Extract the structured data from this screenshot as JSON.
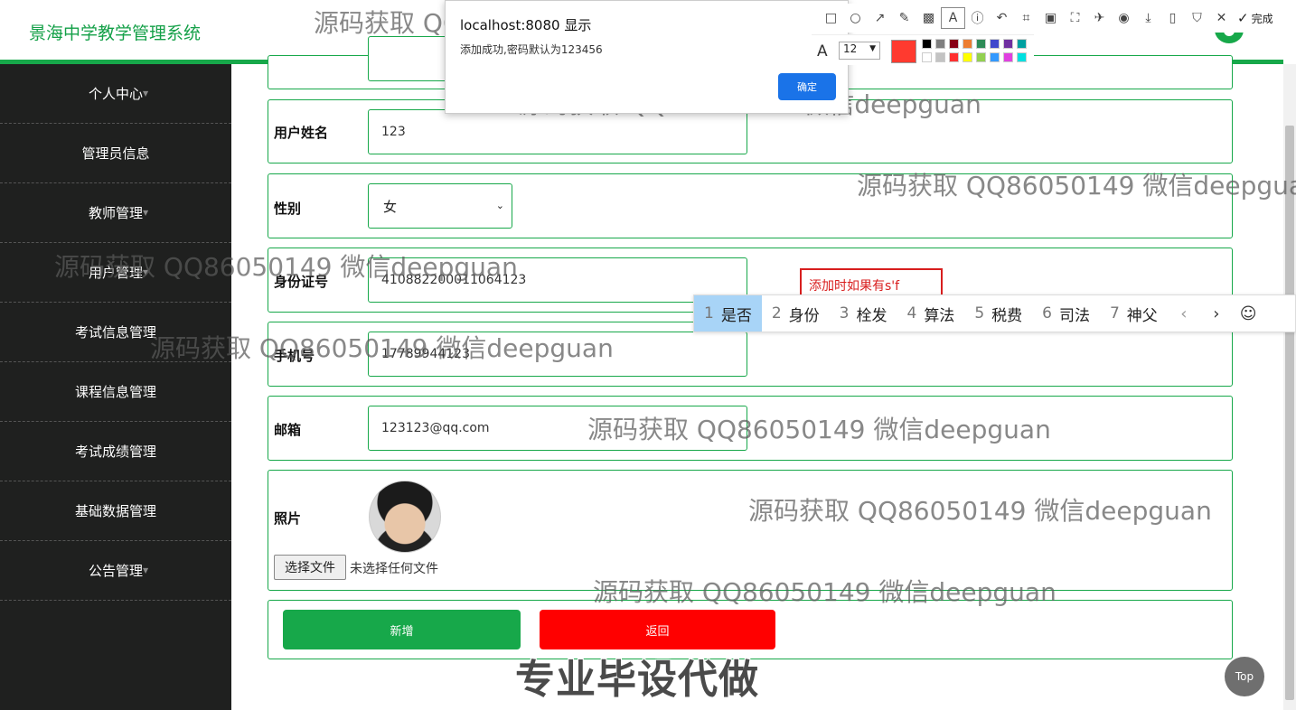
{
  "app": {
    "title": "景海中学教学管理系统"
  },
  "sidebar": {
    "items": [
      {
        "label": "个人中心"
      },
      {
        "label": "管理员信息"
      },
      {
        "label": "教师管理"
      },
      {
        "label": "用户管理"
      },
      {
        "label": "考试信息管理"
      },
      {
        "label": "课程信息管理"
      },
      {
        "label": "考试成绩管理"
      },
      {
        "label": "基础数据管理"
      },
      {
        "label": "公告管理"
      }
    ]
  },
  "form": {
    "name_label": "用户姓名",
    "name_value": "123",
    "gender_label": "性别",
    "gender_value": "女",
    "id_label": "身份证号",
    "id_value": "410882200011064123",
    "phone_label": "手机号",
    "phone_value": "17789944123",
    "email_label": "邮箱",
    "email_value": "123123@qq.com",
    "photo_label": "照片",
    "file_button": "选择文件",
    "file_status": "未选择任何文件",
    "add_button": "新增",
    "back_button": "返回"
  },
  "annotation": {
    "text": "添加时如果有s'f"
  },
  "alert": {
    "title": "localhost:8080 显示",
    "message": "添加成功,密码默认为123456",
    "ok_label": "确定"
  },
  "toolbar": {
    "done_label": "完成",
    "font_size": "12",
    "current_color": "#ff3a2f",
    "palette": [
      "#000000",
      "#7f7f7f",
      "#880015",
      "#ed7d31",
      "#2e8b57",
      "#3f48cc",
      "#7030a0",
      "#00a0a0",
      "#ffffff",
      "#c3c3c3",
      "#ff3030",
      "#ffff00",
      "#92d050",
      "#3399ff",
      "#e040e0",
      "#00e0e0"
    ]
  },
  "ime": {
    "candidates": [
      {
        "num": "1",
        "text": "是否"
      },
      {
        "num": "2",
        "text": "身份"
      },
      {
        "num": "3",
        "text": "栓发"
      },
      {
        "num": "4",
        "text": "算法"
      },
      {
        "num": "5",
        "text": "税费"
      },
      {
        "num": "6",
        "text": "司法"
      },
      {
        "num": "7",
        "text": "神父"
      }
    ]
  },
  "top_button": "Top",
  "watermarks": {
    "text": "源码获取 QQ86050149 微信deepguan",
    "big_text": "专业毕设代做"
  }
}
